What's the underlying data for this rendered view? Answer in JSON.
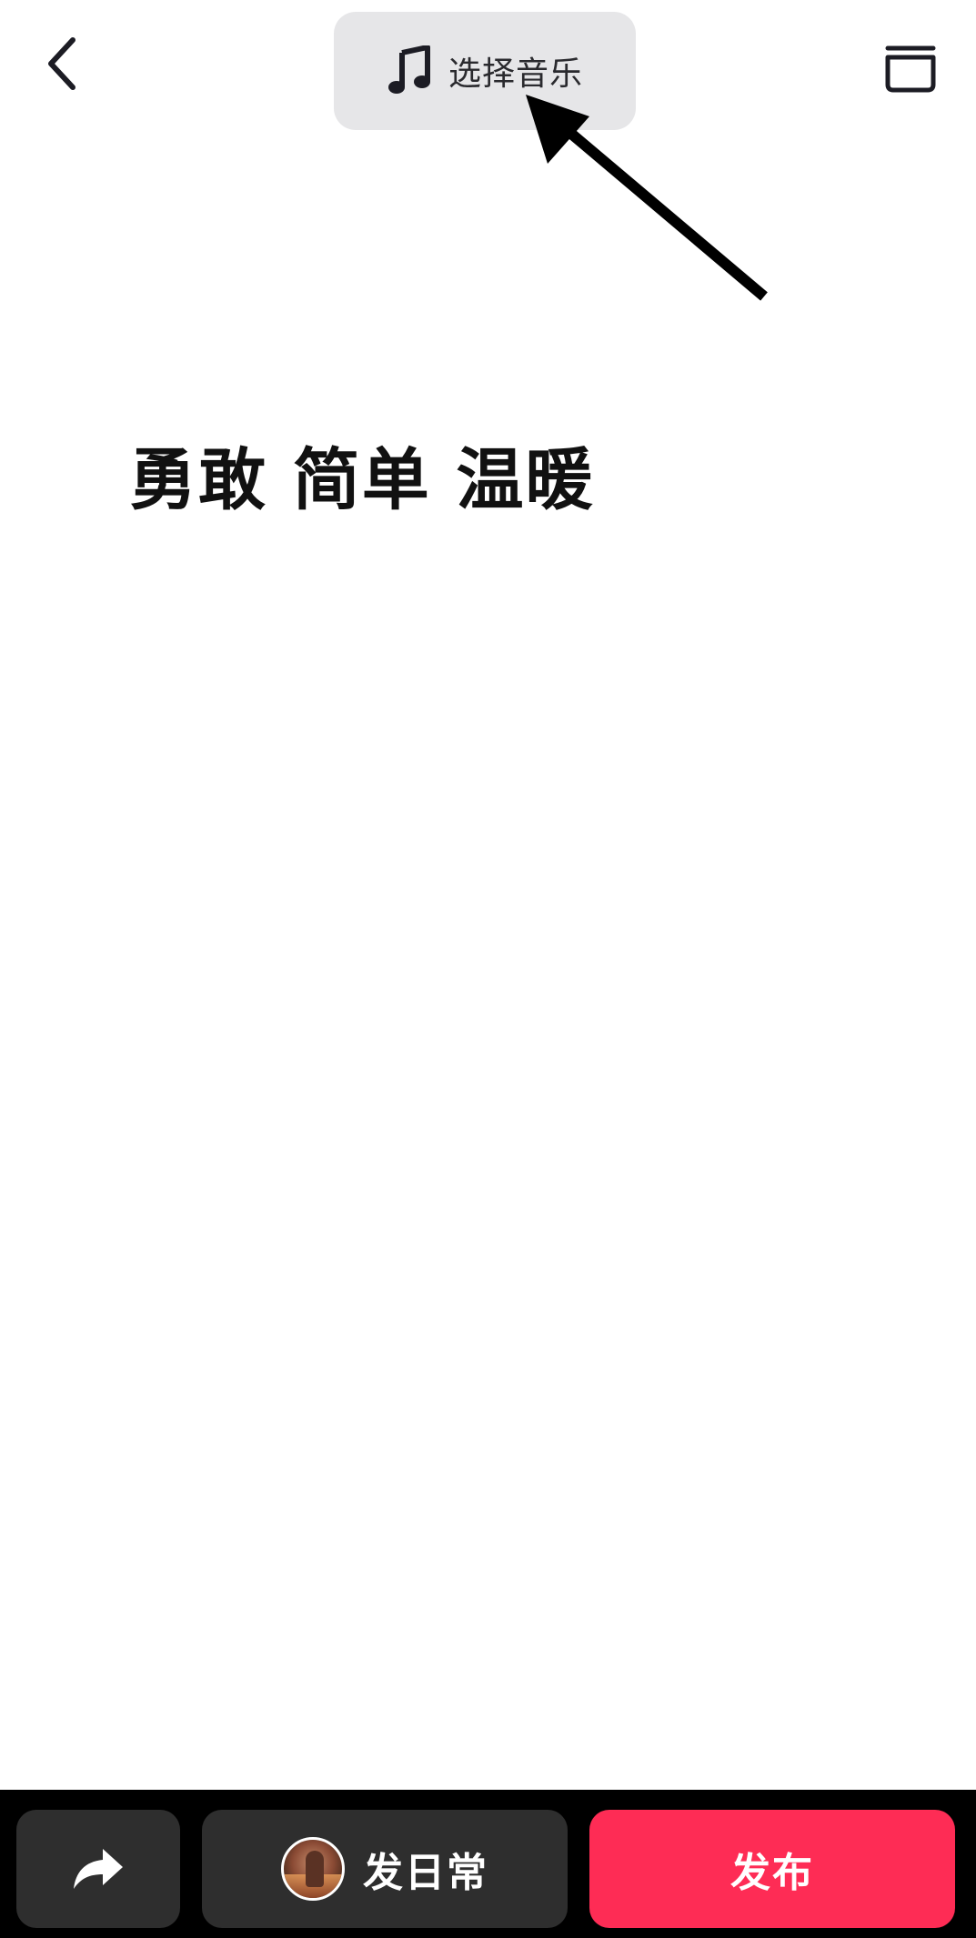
{
  "header": {
    "back_icon": "chevron-left-icon",
    "music_button": {
      "icon": "music-note-icon",
      "label": "选择音乐"
    },
    "trash_icon": "trash-icon"
  },
  "annotation": {
    "arrow_icon": "arrow-pointer-icon",
    "arrow_color": "#000000"
  },
  "content": {
    "text": "勇敢 简单 温暖"
  },
  "bottom_bar": {
    "share_icon": "share-arrow-icon",
    "daily_button": {
      "avatar": "user-avatar",
      "label": "发日常"
    },
    "publish_button": {
      "label": "发布"
    }
  },
  "colors": {
    "background": "#ffffff",
    "pill_background": "#e6e6e8",
    "bottom_bar_background": "#000000",
    "secondary_button": "#2e2e2e",
    "publish_accent": "#fe2c55"
  }
}
